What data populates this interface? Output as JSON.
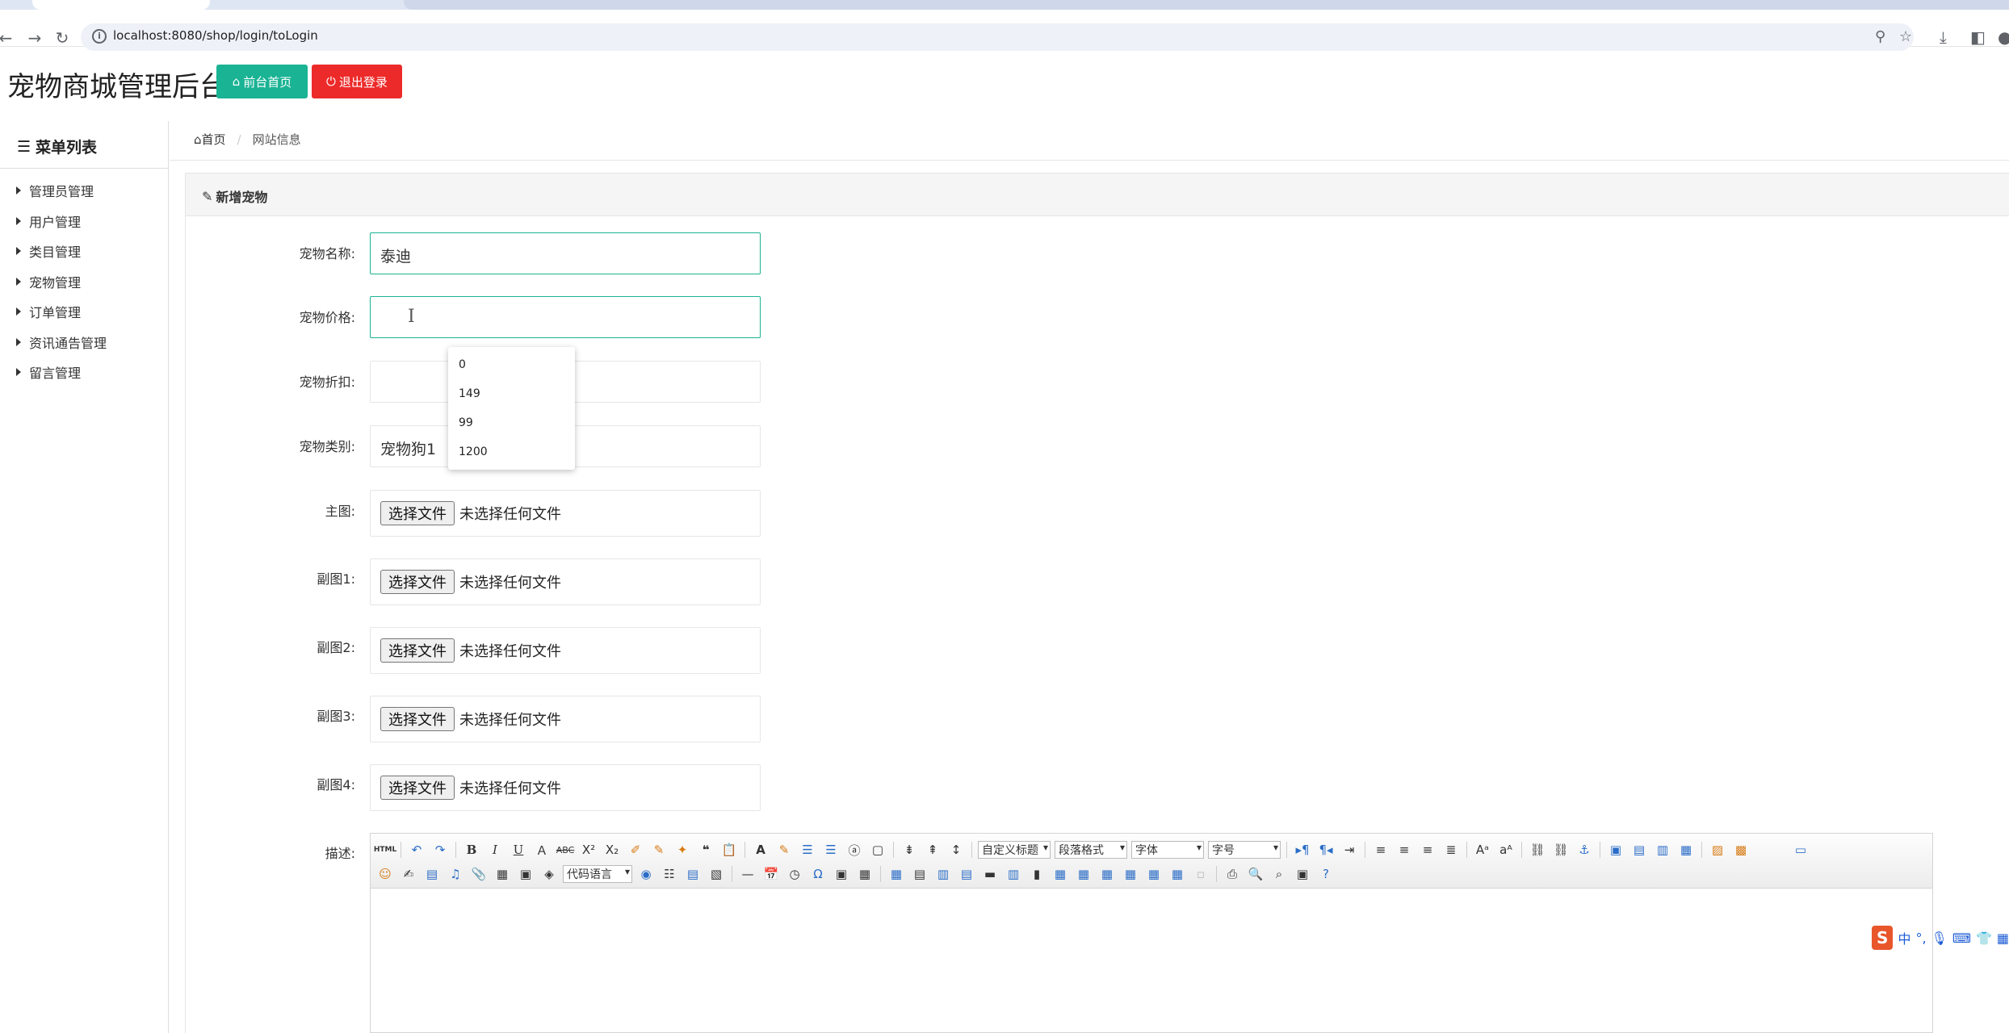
{
  "browser": {
    "url": "localhost:8080/shop/login/toLogin",
    "icons": [
      "back-icon",
      "forward-icon",
      "reload-icon",
      "site-info-icon",
      "zoom-icon",
      "bookmark-star-icon",
      "download-icon",
      "sidebar-icon",
      "profile-icon"
    ]
  },
  "header": {
    "title": "宠物商城管理后台",
    "front_button": "前台首页",
    "logout_button": "退出登录",
    "colors": {
      "front": "#1ab394",
      "logout": "#ed2a2a"
    }
  },
  "sidebar": {
    "title": "菜单列表",
    "items": [
      "管理员管理",
      "用户管理",
      "类目管理",
      "宠物管理",
      "订单管理",
      "资讯通告管理",
      "留言管理"
    ]
  },
  "breadcrumb": {
    "home": "首页",
    "current": "网站信息"
  },
  "panel": {
    "title": "新增宠物"
  },
  "form": {
    "name_label": "宠物名称:",
    "name_value": "泰迪",
    "price_label": "宠物价格:",
    "price_value": "",
    "discount_label": "宠物折扣:",
    "discount_value": "",
    "category_label": "宠物类别:",
    "category_value": "宠物狗1",
    "main_image_label": "主图:",
    "sub1_label": "副图1:",
    "sub2_label": "副图2:",
    "sub3_label": "副图3:",
    "sub4_label": "副图4:",
    "desc_label": "描述:",
    "file_button": "选择文件",
    "file_none": "未选择任何文件"
  },
  "autocomplete": [
    "0",
    "149",
    "99",
    "1200"
  ],
  "editor": {
    "html_label": "HTML",
    "custom_title": "自定义标题",
    "paragraph_format": "段落格式",
    "font_family": "字体",
    "font_size": "字号",
    "code_language": "代码语言"
  },
  "ime": {
    "logo": "S",
    "lang": "中"
  }
}
